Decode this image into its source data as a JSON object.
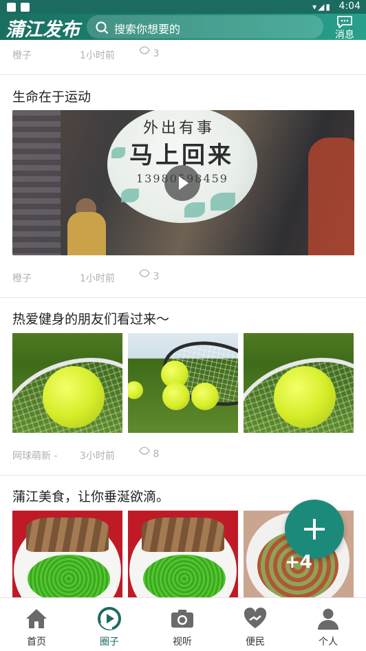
{
  "status_bar": {
    "time": "4:04"
  },
  "header": {
    "logo_text": "蒲江发布",
    "search_placeholder": "搜索你想要的",
    "message_label": "消息",
    "brand_color": "#1c6b60"
  },
  "posts": [
    {
      "author": "橙子",
      "time": "1小时前",
      "views": "3"
    },
    {
      "title": "生命在于运动",
      "author": "橙子",
      "time": "1小时前",
      "views": "3",
      "media": "video",
      "video_sign": {
        "line1": "外出有事",
        "line2": "马上回来",
        "line3": "13980598459"
      }
    },
    {
      "title": "热爱健身的朋友们看过来～",
      "author": "网球萌新 -",
      "time": "3小时前",
      "views": "8",
      "media": "images"
    },
    {
      "title": "蒲江美食，让你垂涎欲滴。",
      "media": "images",
      "more_images": "+4"
    }
  ],
  "tabs": [
    {
      "label": "首页",
      "icon": "home-icon",
      "active": false
    },
    {
      "label": "圈子",
      "icon": "circle-play-icon",
      "active": true
    },
    {
      "label": "视听",
      "icon": "camera-icon",
      "active": false
    },
    {
      "label": "便民",
      "icon": "heart-icon",
      "active": false
    },
    {
      "label": "个人",
      "icon": "person-icon",
      "active": false
    }
  ]
}
